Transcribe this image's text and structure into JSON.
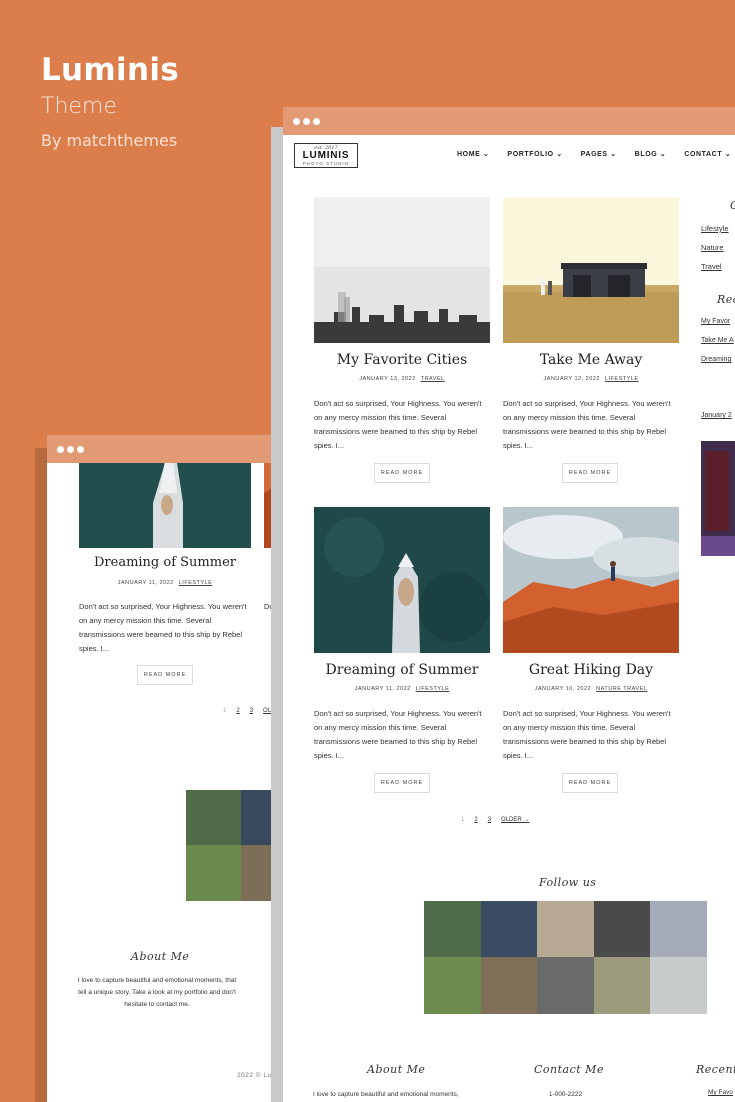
{
  "brand": {
    "title": "Luminis",
    "subtitle": "Theme",
    "byline": "By matchthemes"
  },
  "site": {
    "logo_est": "est. 2017",
    "logo_name": "LUMINIS",
    "logo_tag": "PHOTO STUDIO",
    "nav": [
      "HOME ⌄",
      "PORTFOLIO ⌄",
      "PAGES ⌄",
      "BLOG ⌄",
      "CONTACT ⌄"
    ]
  },
  "posts": [
    {
      "title": "My Favorite Cities",
      "date": "JANUARY 13, 2022",
      "category": "TRAVEL"
    },
    {
      "title": "Take Me Away",
      "date": "JANUARY 12, 2022",
      "category": "LIFESTYLE"
    },
    {
      "title": "Dreaming of Summer",
      "date": "JANUARY 11, 2022",
      "category": "LIFESTYLE"
    },
    {
      "title": "Great Hiking Day",
      "date": "JANUARY 10, 2022",
      "category": "NATURE TRAVEL"
    }
  ],
  "excerpt": "Don't act so surprised, Your Highness. You weren't on any mercy mission this time. Several transmissions were beamed to this ship by Rebel spies. I...",
  "excerpt_back_partial": "Don't",
  "read_more": "READ MORE",
  "pagination": {
    "page1": "1",
    "page2": "2",
    "page3": "3",
    "older": "OLDER →",
    "older_back": "OLDER"
  },
  "sidebar": {
    "categories_title_partial": "C",
    "categories": [
      "Lifestyle",
      "Nature",
      "Travel"
    ],
    "recent_title_partial": "Rec",
    "recent": [
      "My Favor",
      "Take Me A",
      "Dreaming"
    ],
    "archive_partial": "January 2"
  },
  "footer": {
    "follow_title": "Follow us",
    "about_title": "About Me",
    "about_text": "I love to capture beautiful and emotional moments, that tell a unique story. Take a look at my portfolio and don't hesitate to contact me.",
    "about_text_front": "I love to capture beautiful and emotional moments,",
    "contact_title": "Contact Me",
    "contact_phone": "1-000-2222",
    "recent_title_partial": "Recent",
    "recent_link_partial": "My Favo",
    "copyright_partial": "2022 © Lum"
  },
  "colors": {
    "background": "#dc7d4c",
    "titlebar": "#e29a74"
  }
}
